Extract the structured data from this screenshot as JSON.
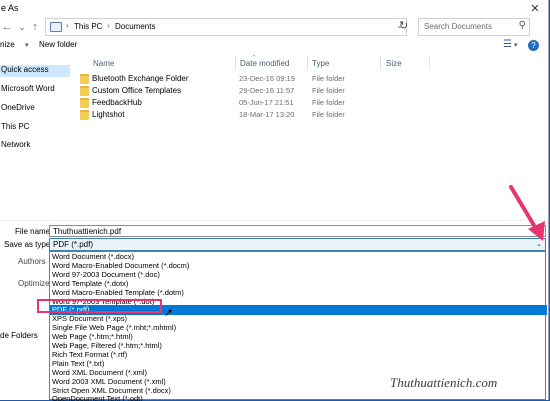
{
  "window": {
    "title": "e As"
  },
  "address_bar": {
    "crumbs": [
      "This PC",
      "Documents"
    ],
    "search_placeholder": "Search Documents"
  },
  "toolbar": {
    "organize_label": "nize",
    "new_folder_label": "New folder"
  },
  "nav_pane": {
    "items": [
      {
        "label": "Quick access",
        "selected": true
      },
      {
        "label": "Microsoft Word"
      },
      {
        "label": "OneDrive"
      },
      {
        "label": "This PC"
      },
      {
        "label": "Network"
      }
    ]
  },
  "columns": [
    "Name",
    "Date modified",
    "Type",
    "Size"
  ],
  "files": [
    {
      "name": "Bluetooth Exchange Folder",
      "date": "23-Dec-16 09:19",
      "type": "File folder"
    },
    {
      "name": "Custom Office Templates",
      "date": "29-Dec-16 11:57",
      "type": "File folder"
    },
    {
      "name": "FeedbackHub",
      "date": "05-Jun-17 21:51",
      "type": "File folder"
    },
    {
      "name": "Lightshot",
      "date": "18-Mar-17 13:20",
      "type": "File folder"
    }
  ],
  "form": {
    "filename_label": "File name:",
    "filename_value": "Thuthuattienich.pdf",
    "savetype_label": "Save as type:",
    "savetype_value": "PDF (*.pdf)",
    "authors_label": "Authors",
    "optimize_label": "Optimize",
    "hide_folders_label": "de Folders"
  },
  "save_type_options": [
    "Word Document (*.docx)",
    "Word Macro-Enabled Document (*.docm)",
    "Word 97-2003 Document (*.doc)",
    "Word Template (*.dotx)",
    "Word Macro-Enabled Template (*.dotm)",
    "Word 97-2003 Template (*.dot)",
    "PDF (*.pdf)",
    "XPS Document (*.xps)",
    "Single File Web Page (*.mht;*.mhtml)",
    "Web Page (*.htm;*.html)",
    "Web Page, Filtered (*.htm;*.html)",
    "Rich Text Format (*.rtf)",
    "Plain Text (*.txt)",
    "Word XML Document (*.xml)",
    "Word 2003 XML Document (*.xml)",
    "Strict Open XML Document (*.docx)",
    "OpenDocument Text (*.odt)"
  ],
  "selected_option_index": 6,
  "watermark": "Thuthuattienich.com",
  "colors": {
    "selection": "#0078d7",
    "highlight_box": "#e8356e",
    "arrow": "#e8356e"
  }
}
